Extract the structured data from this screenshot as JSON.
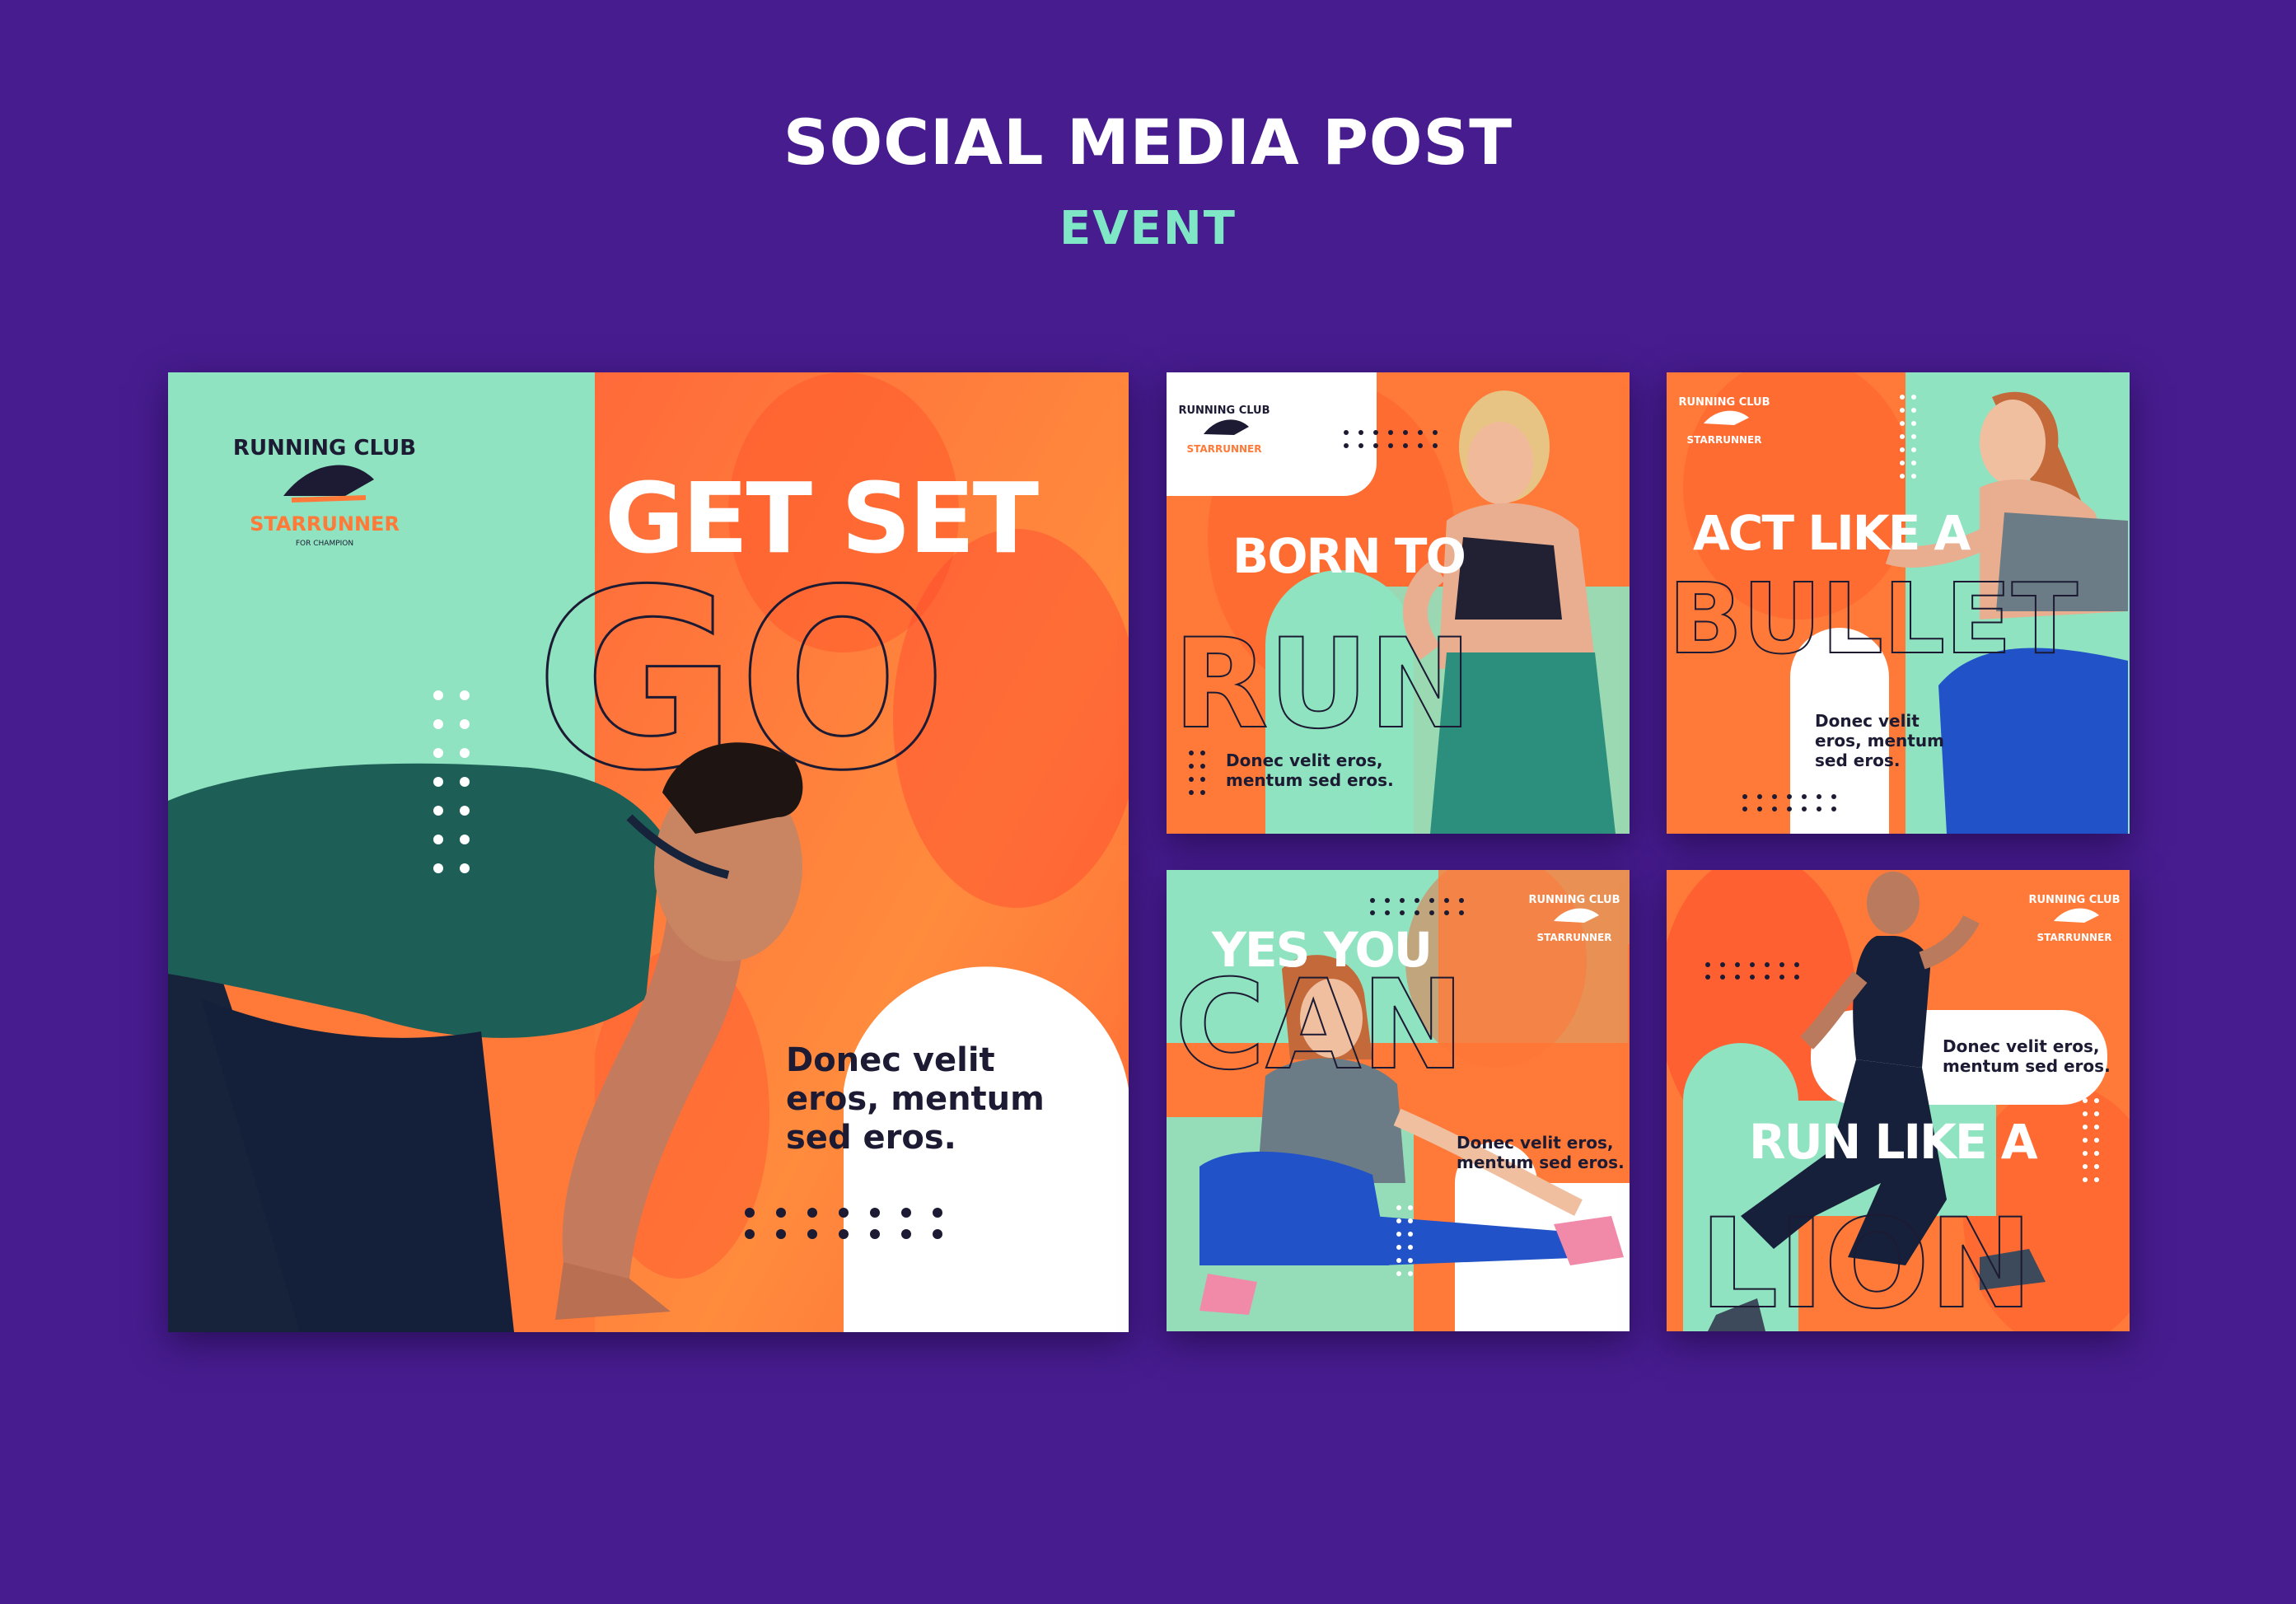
{
  "header": {
    "title": "SOCIAL MEDIA POST",
    "subtitle": "EVENT"
  },
  "colors": {
    "background": "#471c8f",
    "mint": "#8fe3c0",
    "orange": "#ff7a38",
    "coral": "#ff4d3a",
    "navy": "#1c1b33",
    "white": "#ffffff",
    "accent_text": "#7fe6c6"
  },
  "brand": {
    "arc_text": "RUNNING CLUB",
    "name": "STARRUNNER",
    "tagline": "FOR CHAMPION"
  },
  "posts": [
    {
      "headline_solid": "GET SET",
      "headline_outline": "GO",
      "body_line1": "Donec velit",
      "body_line2": "eros, mentum",
      "body_line3": "sed eros."
    },
    {
      "headline_solid": "BORN TO",
      "headline_outline": "RUN",
      "body_line1": "Donec velit eros,",
      "body_line2": "mentum sed eros."
    },
    {
      "headline_solid": "ACT LIKE A",
      "headline_outline": "BULLET",
      "body_line1": "Donec velit",
      "body_line2": "eros, mentum",
      "body_line3": "sed eros."
    },
    {
      "headline_solid": "YES YOU",
      "headline_outline": "CAN",
      "body_line1": "Donec velit eros,",
      "body_line2": "mentum sed eros."
    },
    {
      "headline_solid": "RUN LIKE A",
      "headline_outline": "LION",
      "body_line1": "Donec velit eros,",
      "body_line2": "mentum sed eros."
    }
  ]
}
